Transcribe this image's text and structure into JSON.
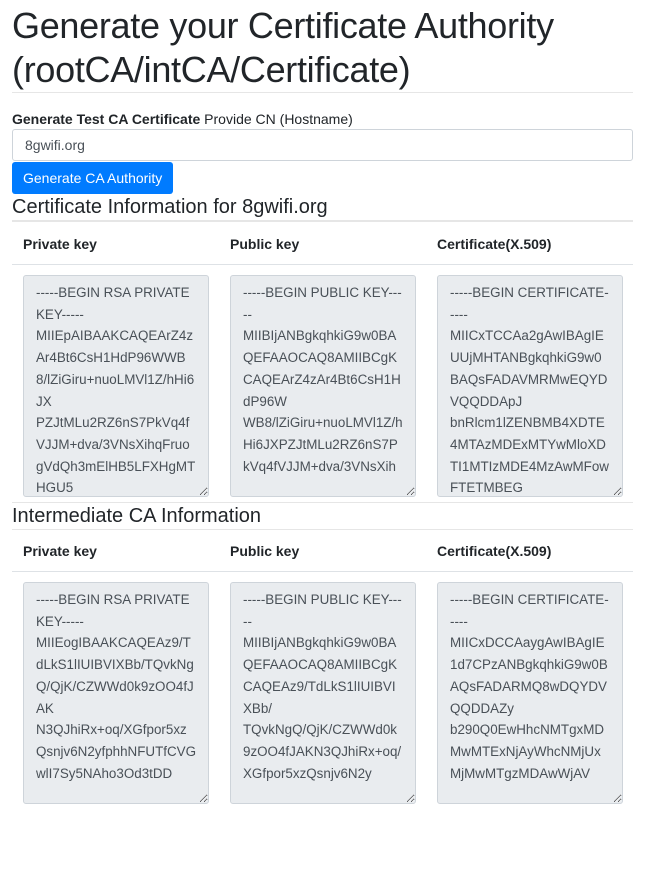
{
  "page": {
    "title": "Generate your Certificate Authority (rootCA/intCA/Certificate)"
  },
  "form": {
    "label_bold": "Generate Test CA Certificate",
    "label_rest": " Provide CN (Hostname)",
    "cn_value": "8gwifi.org",
    "submit_label": "Generate CA Authority",
    "accent_color": "#007bff"
  },
  "root_section": {
    "heading": "Certificate Information for 8gwifi.org",
    "columns": [
      "Private key",
      "Public key",
      "Certificate(X.509)"
    ],
    "private_key": "-----BEGIN RSA PRIVATE KEY-----\nMIIEpAIBAAKCAQEArZ4zAr4Bt6CsH1HdP96WWB8/lZiGiru+nuoLMVl1Z/hHi6JX\nPZJtMLu2RZ6nS7PkVq4fVJJM+dva/3VNsXihqFruogVdQh3mElHB5LFXHgMTHGU5",
    "public_key": "-----BEGIN PUBLIC KEY-----\nMIIBIjANBgkqhkiG9w0BAQEFAAOCAQ8AMIIBCgKCAQEArZ4zAr4Bt6CsH1HdP96W\nWB8/lZiGiru+nuoLMVl1Z/hHi6JXPZJtMLu2RZ6nS7PkVq4fVJJM+dva/3VNsXih",
    "certificate": "-----BEGIN CERTIFICATE-----\nMIICxTCCAa2gAwIBAgIEUUjMHTANBgkqhkiG9w0BAQsFADAVMRMwEQYDVQQDDApJ\nbnRlcm1lZENBMB4XDTE4MTAzMDExMTYwMloXDTI1MTIzMDE4MzAwMFowFTETMBEG"
  },
  "intermediate_section": {
    "heading": "Intermediate CA Information",
    "columns": [
      "Private key",
      "Public key",
      "Certificate(X.509)"
    ],
    "private_key": "-----BEGIN RSA PRIVATE KEY-----\nMIIEogIBAAKCAQEAz9/TdLkS1lIUIBVIXBb/TQvkNgQ/QjK/CZWWd0k9zOO4fJAK\nN3QJhiRx+oq/XGfpor5xzQsnjv6N2yfphhNFUTfCVGwlI7Sy5NAho3Od3tDD",
    "public_key": "-----BEGIN PUBLIC KEY-----\nMIIBIjANBgkqhkiG9w0BAQEFAAOCAQ8AMIIBCgKCAQEAz9/TdLkS1lIUIBVIXBb/\nTQvkNgQ/QjK/CZWWd0k9zOO4fJAKN3QJhiRx+oq/XGfpor5xzQsnjv6N2y",
    "certificate": "-----BEGIN CERTIFICATE-----\nMIICxDCCAaygAwIBAgIE1d7CPzANBgkqhkiG9w0BAQsFADARMQ8wDQYDVQQDDAZy\nb290Q0EwHhcNMTgxMDMwMTExNjAyWhcNMjUxMjMwMTgzMDAwWjAV"
  }
}
